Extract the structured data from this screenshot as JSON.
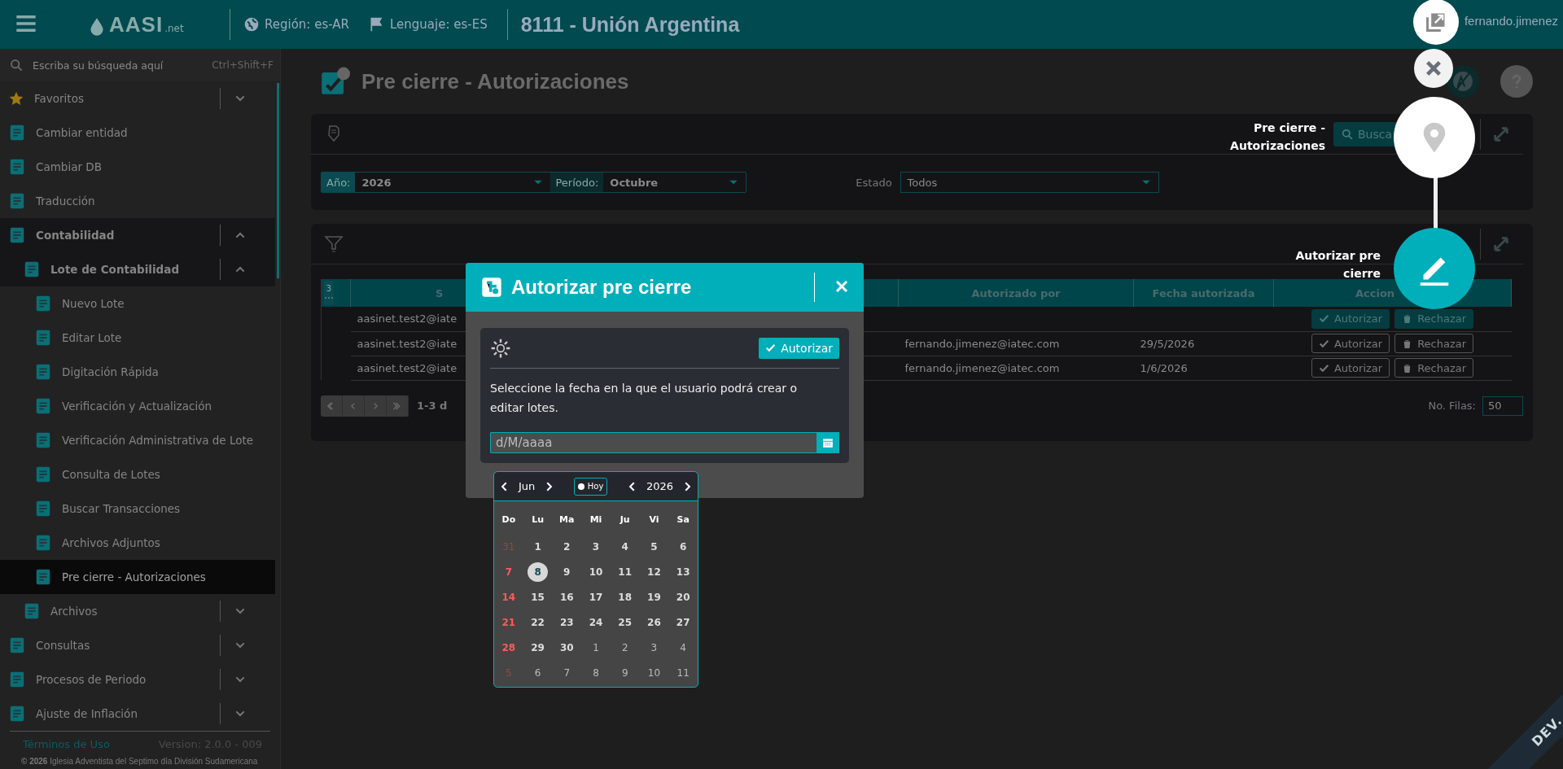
{
  "topbar": {
    "logo": {
      "name": "AASI",
      "suffix": ".net"
    },
    "region": "Región: es-AR",
    "language": "Lenguaje: es-ES",
    "entity": "8111 - Unión Argentina",
    "user": "fernando.jimenez"
  },
  "sidebar": {
    "search": {
      "placeholder": "Escriba su búsqueda aquí",
      "shortcut": "Ctrl+Shift+F"
    },
    "items": [
      {
        "label": "Favoritos",
        "kind": "group",
        "expanded": false,
        "selected": false
      },
      {
        "label": "Cambiar entidad",
        "kind": "link",
        "selected": false
      },
      {
        "label": "Cambiar DB",
        "kind": "link",
        "selected": false
      },
      {
        "label": "Traducción",
        "kind": "link",
        "selected": false
      },
      {
        "label": "Contabilidad",
        "kind": "group",
        "expanded": true,
        "selected": false,
        "children": [
          {
            "label": "Lote de Contabilidad",
            "kind": "group",
            "expanded": true,
            "selected": false,
            "children": [
              {
                "label": "Nuevo Lote",
                "kind": "link",
                "selected": false
              },
              {
                "label": "Editar Lote",
                "kind": "link",
                "selected": false
              },
              {
                "label": "Digitación Rápida",
                "kind": "link",
                "selected": false
              },
              {
                "label": "Verificación y Actualización",
                "kind": "link",
                "selected": false
              },
              {
                "label": "Verificación Administrativa de Lote",
                "kind": "link",
                "selected": false
              },
              {
                "label": "Consulta de Lotes",
                "kind": "link",
                "selected": false
              },
              {
                "label": "Buscar Transacciones",
                "kind": "link",
                "selected": false
              },
              {
                "label": "Archivos Adjuntos",
                "kind": "link",
                "selected": false
              },
              {
                "label": "Pre cierre - Autorizaciones",
                "kind": "link",
                "selected": true
              }
            ]
          },
          {
            "label": "Archivos",
            "kind": "group",
            "expanded": false,
            "selected": false
          }
        ]
      },
      {
        "label": "Consultas",
        "kind": "group",
        "expanded": false,
        "selected": false
      },
      {
        "label": "Procesos de Periodo",
        "kind": "group",
        "expanded": false,
        "selected": false
      },
      {
        "label": "Ajuste de Inflación",
        "kind": "group",
        "expanded": false,
        "selected": false
      }
    ],
    "footer": {
      "terms": "Términos de Uso",
      "version": "Version: 2.0.0 - 009",
      "copyright": "**© 2026** Iglesia Adventista del Septimo día División Sudamericana"
    }
  },
  "page": {
    "title": "Pre cierre - Autorizaciones"
  },
  "filters": {
    "search_button": "Busca",
    "fields": [
      {
        "label": "Año:",
        "value": "2026"
      },
      {
        "label": "Período:",
        "value": "Octubre"
      }
    ],
    "status": {
      "label": "Estado",
      "value": "Todos"
    }
  },
  "table": {
    "page_size": "3",
    "columns": [
      "S",
      "Autorizado por",
      "Fecha autorizada",
      "Accion"
    ],
    "rows": [
      {
        "user": "aasinet.test2@iate",
        "pending": true,
        "actions": [
          "Autorizar",
          "Rechazar"
        ]
      },
      {
        "user": "aasinet.test2@iate",
        "authorized_by": "fernando.jimenez@iatec.com",
        "date": "29/5/2026",
        "pending": false,
        "actions": [
          "Autorizar",
          "Rechazar"
        ]
      },
      {
        "user": "aasinet.test2@iate",
        "authorized_by": "fernando.jimenez@iatec.com",
        "date": "1/6/2026",
        "pending": false,
        "actions": [
          "Autorizar",
          "Rechazar"
        ]
      }
    ],
    "range": "1-3 d",
    "rows_label": "No. Filas:",
    "rows_value": "50"
  },
  "modal": {
    "title": "Autorizar pre cierre",
    "action": "Autorizar",
    "message": "Seleccione la fecha en la que el usuario podrá crear o editar lotes.",
    "date_field": {
      "placeholder": "d/M/aaaa"
    },
    "calendar": {
      "month": "Jun",
      "today_button": "Hoy",
      "year": "2026",
      "weekdays": [
        "Do",
        "Lu",
        "Ma",
        "Mi",
        "Ju",
        "Vi",
        "Sa"
      ],
      "weeks": [
        [
          {
            "day": "31",
            "outside": true,
            "today": false
          },
          {
            "day": "1",
            "outside": false,
            "today": false
          },
          {
            "day": "2",
            "outside": false,
            "today": false
          },
          {
            "day": "3",
            "outside": false,
            "today": false
          },
          {
            "day": "4",
            "outside": false,
            "today": false
          },
          {
            "day": "5",
            "outside": false,
            "today": false
          },
          {
            "day": "6",
            "outside": false,
            "today": false
          }
        ],
        [
          {
            "day": "7",
            "outside": false,
            "today": false
          },
          {
            "day": "8",
            "outside": false,
            "today": true
          },
          {
            "day": "9",
            "outside": false,
            "today": false
          },
          {
            "day": "10",
            "outside": false,
            "today": false
          },
          {
            "day": "11",
            "outside": false,
            "today": false
          },
          {
            "day": "12",
            "outside": false,
            "today": false
          },
          {
            "day": "13",
            "outside": false,
            "today": false
          }
        ],
        [
          {
            "day": "14",
            "outside": false,
            "today": false
          },
          {
            "day": "15",
            "outside": false,
            "today": false
          },
          {
            "day": "16",
            "outside": false,
            "today": false
          },
          {
            "day": "17",
            "outside": false,
            "today": false
          },
          {
            "day": "18",
            "outside": false,
            "today": false
          },
          {
            "day": "19",
            "outside": false,
            "today": false
          },
          {
            "day": "20",
            "outside": false,
            "today": false
          }
        ],
        [
          {
            "day": "21",
            "outside": false,
            "today": false
          },
          {
            "day": "22",
            "outside": false,
            "today": false
          },
          {
            "day": "23",
            "outside": false,
            "today": false
          },
          {
            "day": "24",
            "outside": false,
            "today": false
          },
          {
            "day": "25",
            "outside": false,
            "today": false
          },
          {
            "day": "26",
            "outside": false,
            "today": false
          },
          {
            "day": "27",
            "outside": false,
            "today": false
          }
        ],
        [
          {
            "day": "28",
            "outside": false,
            "today": false
          },
          {
            "day": "29",
            "outside": false,
            "today": false
          },
          {
            "day": "30",
            "outside": false,
            "today": false
          },
          {
            "day": "1",
            "outside": true,
            "today": false
          },
          {
            "day": "2",
            "outside": true,
            "today": false
          },
          {
            "day": "3",
            "outside": true,
            "today": false
          },
          {
            "day": "4",
            "outside": true,
            "today": false
          }
        ],
        [
          {
            "day": "5",
            "outside": true,
            "today": false
          },
          {
            "day": "6",
            "outside": true,
            "today": false
          },
          {
            "day": "7",
            "outside": true,
            "today": false
          },
          {
            "day": "8",
            "outside": true,
            "today": false
          },
          {
            "day": "9",
            "outside": true,
            "today": false
          },
          {
            "day": "10",
            "outside": true,
            "today": false
          },
          {
            "day": "11",
            "outside": true,
            "today": false
          }
        ]
      ]
    }
  },
  "tour": {
    "steps": [
      {
        "label": "Pre cierre - Autorizaciones",
        "active": false
      },
      {
        "label": "Autorizar pre cierre",
        "active": true
      }
    ]
  },
  "environment_badge": "DEV."
}
